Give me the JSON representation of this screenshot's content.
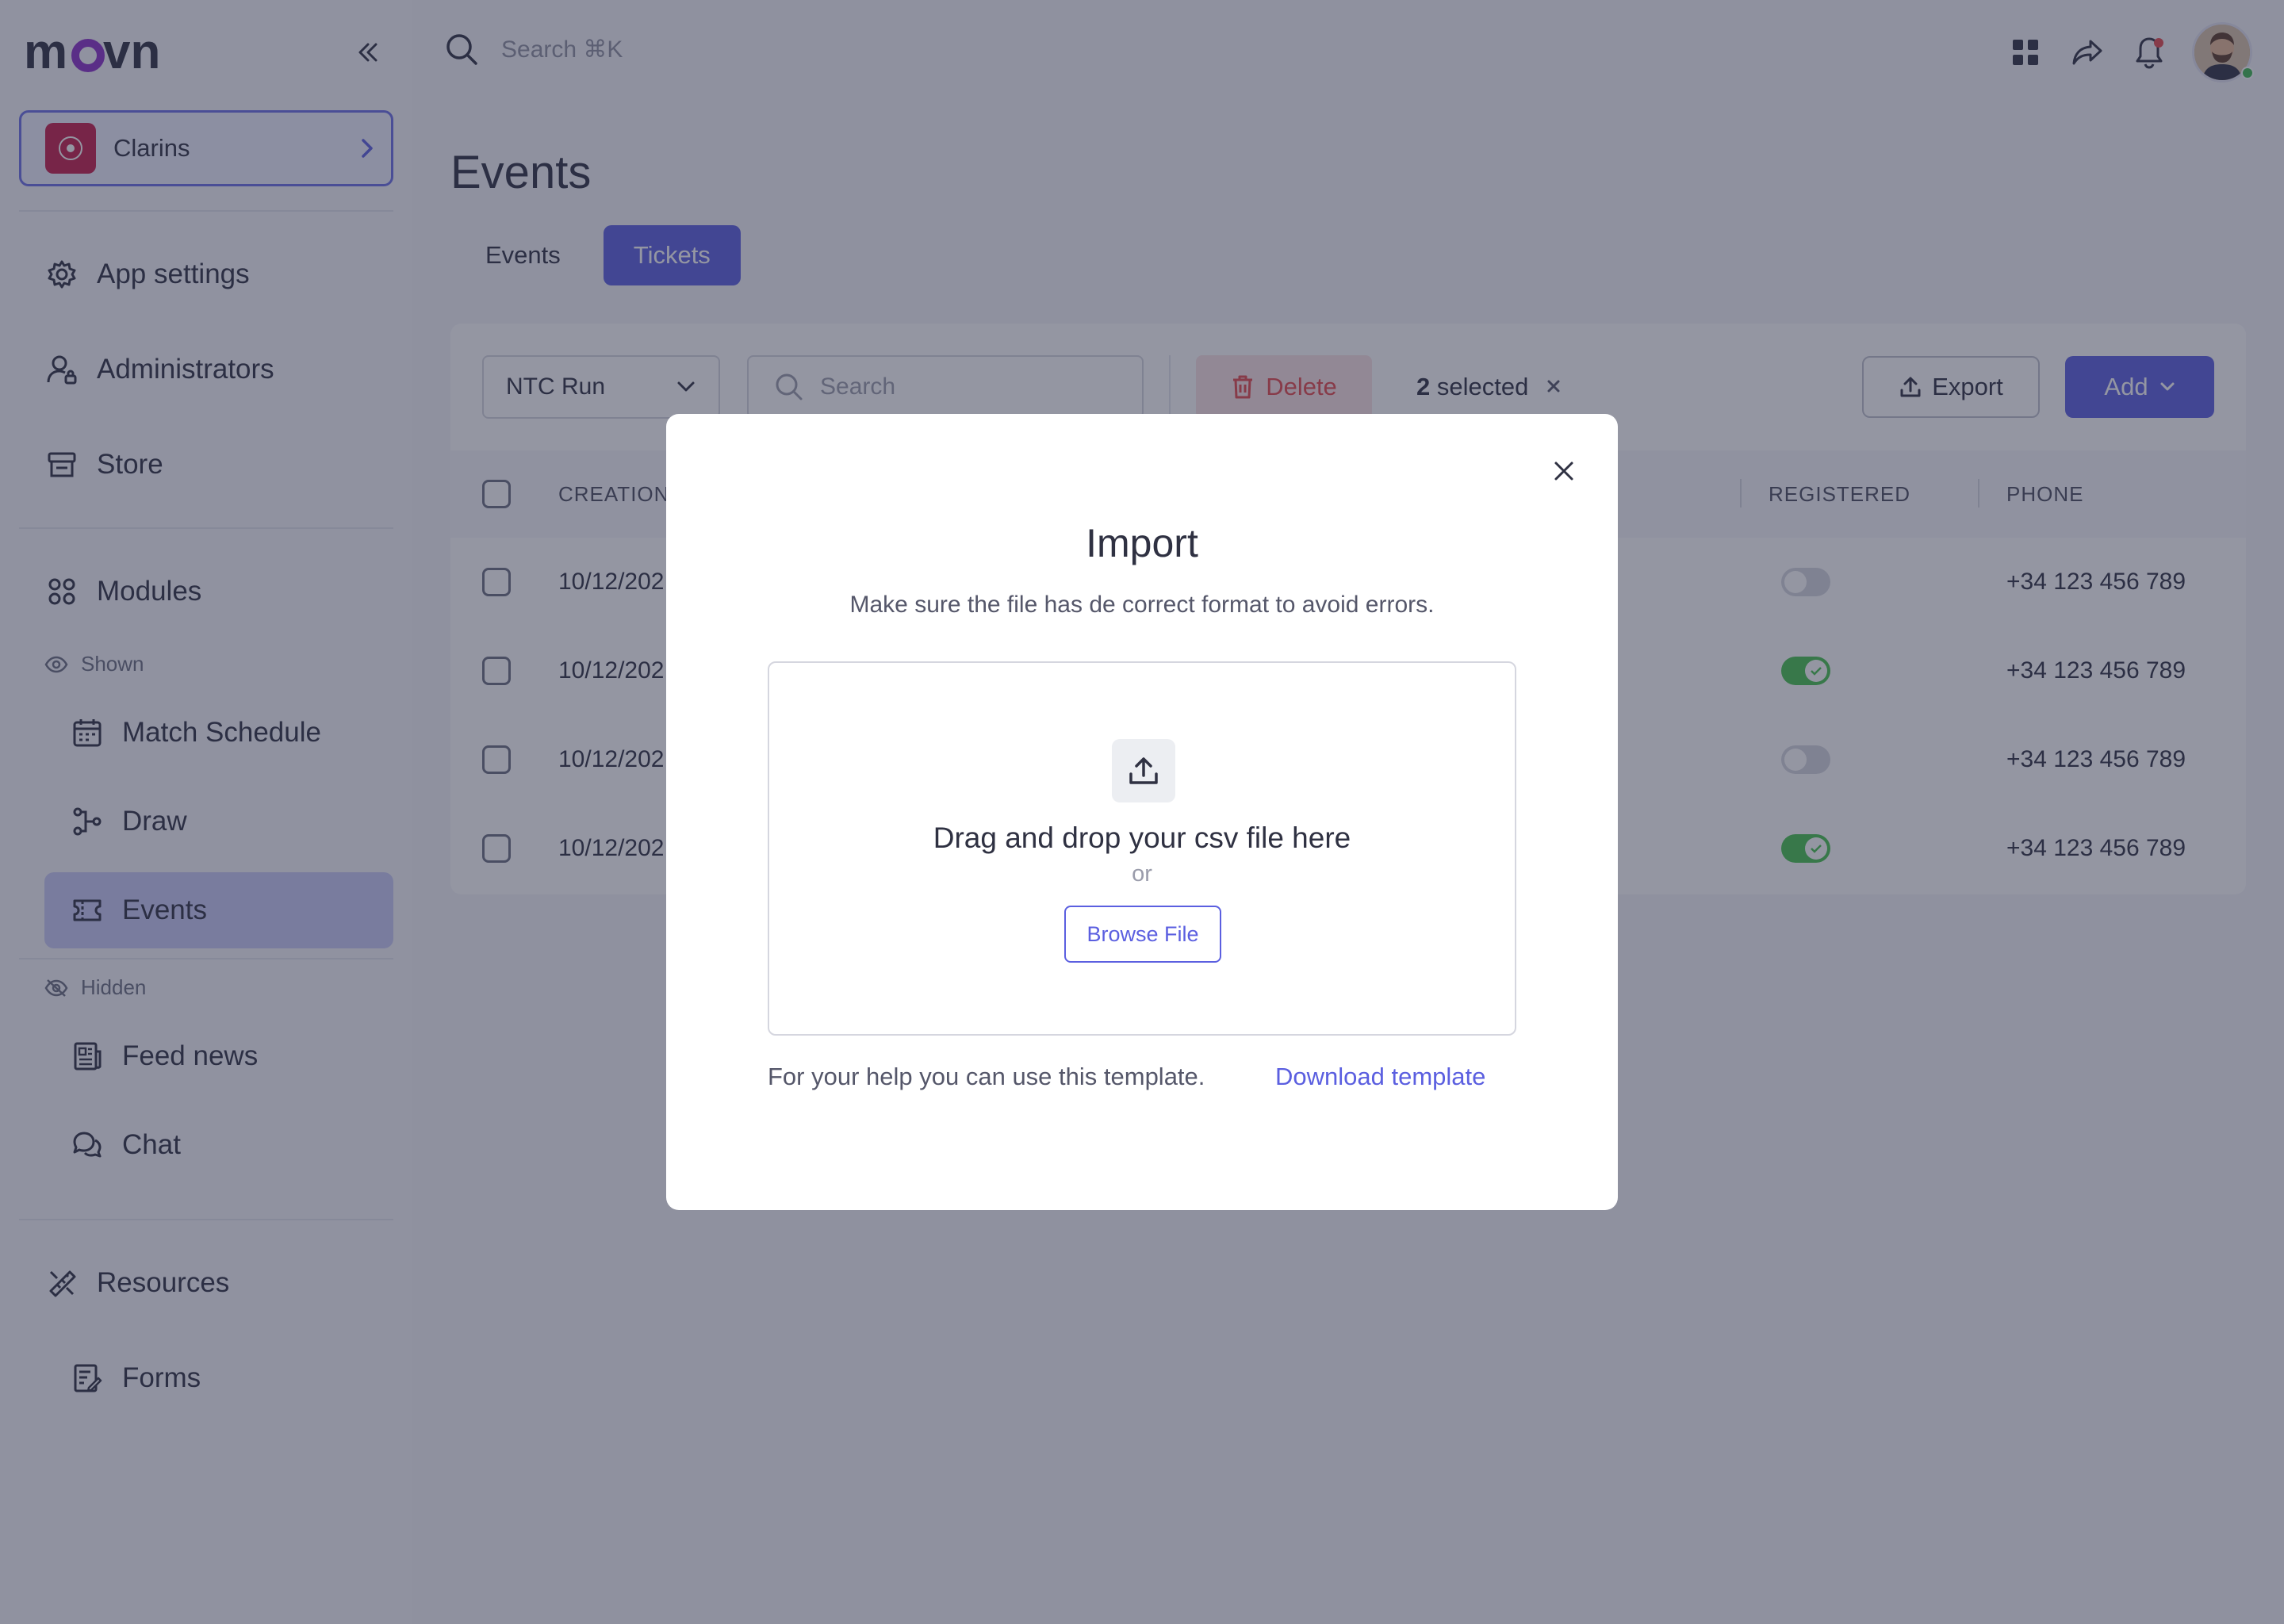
{
  "sidebar": {
    "logo": "movn",
    "org_name": "Clarins",
    "nav_top": [
      {
        "label": "App settings"
      },
      {
        "label": "Administrators"
      },
      {
        "label": "Store"
      }
    ],
    "modules_label": "Modules",
    "shown_label": "Shown",
    "shown_items": [
      {
        "label": "Match Schedule"
      },
      {
        "label": "Draw"
      },
      {
        "label": "Events"
      }
    ],
    "hidden_label": "Hidden",
    "hidden_items": [
      {
        "label": "Feed news"
      },
      {
        "label": "Chat"
      }
    ],
    "resources_label": "Resources",
    "forms_label": "Forms"
  },
  "topbar": {
    "search_placeholder": "Search ⌘K"
  },
  "page": {
    "title": "Events",
    "tabs": [
      {
        "label": "Events",
        "active": false
      },
      {
        "label": "Tickets",
        "active": true
      }
    ]
  },
  "toolbar": {
    "select_value": "NTC Run",
    "search_placeholder": "Search",
    "delete_label": "Delete",
    "selected_count": "2",
    "selected_suffix": "selected",
    "export_label": "Export",
    "add_label": "Add"
  },
  "table": {
    "columns": {
      "creation": "CREATION",
      "registered": "REGISTERED",
      "phone": "PHONE"
    },
    "rows": [
      {
        "creation": "10/12/202",
        "registered": false,
        "phone": "+34 123 456 789"
      },
      {
        "creation": "10/12/202",
        "registered": true,
        "phone": "+34 123 456 789"
      },
      {
        "creation": "10/12/202",
        "registered": false,
        "phone": "+34 123 456 789"
      },
      {
        "creation": "10/12/202",
        "registered": true,
        "phone": "+34 123 456 789"
      }
    ]
  },
  "modal": {
    "title": "Import",
    "subtitle": "Make sure the file has de correct format to avoid errors.",
    "dropzone_title": "Drag and drop your csv file here",
    "dropzone_or": "or",
    "browse_label": "Browse File",
    "help_text": "For your help you can use this template.",
    "download_label": "Download template"
  },
  "colors": {
    "accent": "#5b5fe0",
    "danger": "#e5484d",
    "toggle_on": "#46c24f",
    "brand_purple": "#8b2fc9"
  }
}
